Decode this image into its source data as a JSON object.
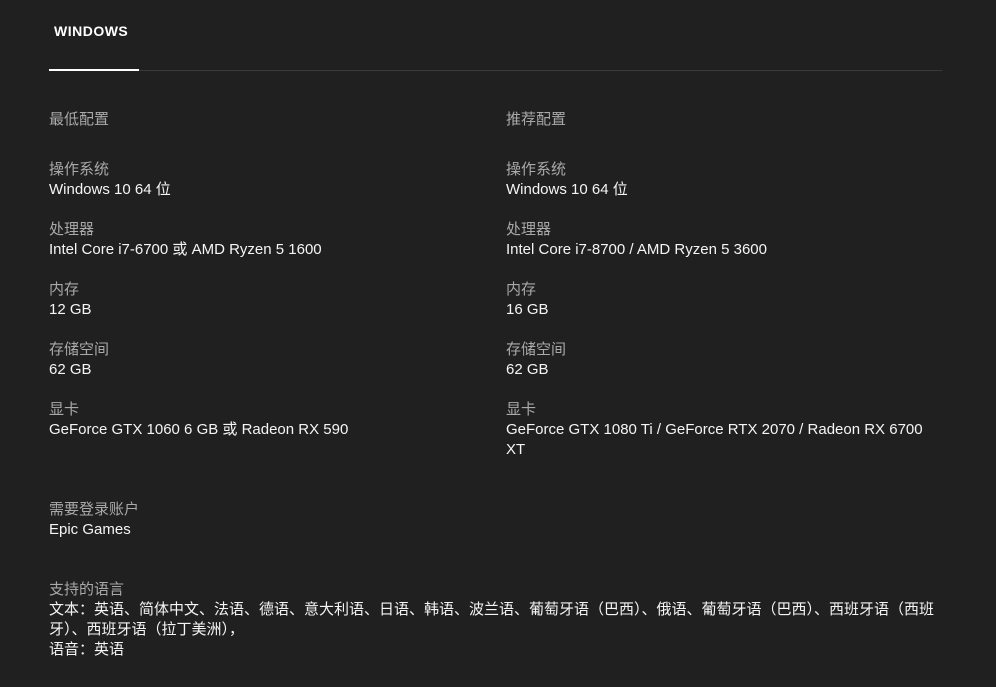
{
  "tab": {
    "label": "WINDOWS"
  },
  "minimum": {
    "heading": "最低配置",
    "specs": [
      {
        "label": "操作系统",
        "value": "Windows 10 64 位"
      },
      {
        "label": "处理器",
        "value": "Intel Core i7-6700 或 AMD Ryzen 5 1600"
      },
      {
        "label": "内存",
        "value": "12 GB"
      },
      {
        "label": "存储空间",
        "value": "62 GB"
      },
      {
        "label": "显卡",
        "value": "GeForce GTX 1060 6 GB 或 Radeon RX 590"
      }
    ]
  },
  "recommended": {
    "heading": "推荐配置",
    "specs": [
      {
        "label": "操作系统",
        "value": "Windows 10 64 位"
      },
      {
        "label": "处理器",
        "value": "Intel Core i7-8700 / AMD Ryzen 5 3600"
      },
      {
        "label": "内存",
        "value": "16 GB"
      },
      {
        "label": "存储空间",
        "value": "62 GB"
      },
      {
        "label": "显卡",
        "value": "GeForce GTX 1080 Ti / GeForce RTX 2070 / Radeon RX 6700 XT"
      }
    ]
  },
  "account": {
    "label": "需要登录账户",
    "value": "Epic Games"
  },
  "languages": {
    "label": "支持的语言",
    "text": "文本：英语、简体中文、法语、德语、意大利语、日语、韩语、波兰语、葡萄牙语（巴西）、俄语、葡萄牙语（巴西）、西班牙语（西班牙）、西班牙语（拉丁美洲），",
    "audio": "语音：英语"
  }
}
